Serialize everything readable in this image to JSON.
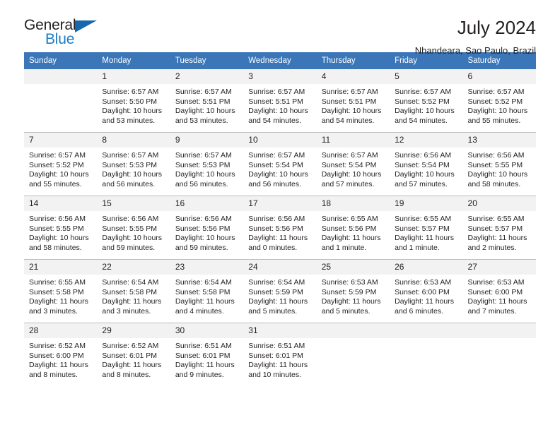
{
  "brand": {
    "name_part1": "General",
    "name_part2": "Blue",
    "triangle_color": "#1667ad",
    "blue_color": "#1e7bc4"
  },
  "header": {
    "title": "July 2024",
    "subtitle": "Nhandeara, Sao Paulo, Brazil",
    "header_bg": "#3a76b8",
    "daynum_bg": "#f2f2f2"
  },
  "weekday_headers": [
    "Sunday",
    "Monday",
    "Tuesday",
    "Wednesday",
    "Thursday",
    "Friday",
    "Saturday"
  ],
  "labels": {
    "sunrise": "Sunrise:",
    "sunset": "Sunset:",
    "daylight": "Daylight:"
  },
  "weeks": [
    [
      {
        "day": "",
        "sunrise": "",
        "sunset": "",
        "daylight_line1": "",
        "daylight_line2": ""
      },
      {
        "day": "1",
        "sunrise": "Sunrise: 6:57 AM",
        "sunset": "Sunset: 5:50 PM",
        "daylight_line1": "Daylight: 10 hours",
        "daylight_line2": "and 53 minutes."
      },
      {
        "day": "2",
        "sunrise": "Sunrise: 6:57 AM",
        "sunset": "Sunset: 5:51 PM",
        "daylight_line1": "Daylight: 10 hours",
        "daylight_line2": "and 53 minutes."
      },
      {
        "day": "3",
        "sunrise": "Sunrise: 6:57 AM",
        "sunset": "Sunset: 5:51 PM",
        "daylight_line1": "Daylight: 10 hours",
        "daylight_line2": "and 54 minutes."
      },
      {
        "day": "4",
        "sunrise": "Sunrise: 6:57 AM",
        "sunset": "Sunset: 5:51 PM",
        "daylight_line1": "Daylight: 10 hours",
        "daylight_line2": "and 54 minutes."
      },
      {
        "day": "5",
        "sunrise": "Sunrise: 6:57 AM",
        "sunset": "Sunset: 5:52 PM",
        "daylight_line1": "Daylight: 10 hours",
        "daylight_line2": "and 54 minutes."
      },
      {
        "day": "6",
        "sunrise": "Sunrise: 6:57 AM",
        "sunset": "Sunset: 5:52 PM",
        "daylight_line1": "Daylight: 10 hours",
        "daylight_line2": "and 55 minutes."
      }
    ],
    [
      {
        "day": "7",
        "sunrise": "Sunrise: 6:57 AM",
        "sunset": "Sunset: 5:52 PM",
        "daylight_line1": "Daylight: 10 hours",
        "daylight_line2": "and 55 minutes."
      },
      {
        "day": "8",
        "sunrise": "Sunrise: 6:57 AM",
        "sunset": "Sunset: 5:53 PM",
        "daylight_line1": "Daylight: 10 hours",
        "daylight_line2": "and 56 minutes."
      },
      {
        "day": "9",
        "sunrise": "Sunrise: 6:57 AM",
        "sunset": "Sunset: 5:53 PM",
        "daylight_line1": "Daylight: 10 hours",
        "daylight_line2": "and 56 minutes."
      },
      {
        "day": "10",
        "sunrise": "Sunrise: 6:57 AM",
        "sunset": "Sunset: 5:54 PM",
        "daylight_line1": "Daylight: 10 hours",
        "daylight_line2": "and 56 minutes."
      },
      {
        "day": "11",
        "sunrise": "Sunrise: 6:57 AM",
        "sunset": "Sunset: 5:54 PM",
        "daylight_line1": "Daylight: 10 hours",
        "daylight_line2": "and 57 minutes."
      },
      {
        "day": "12",
        "sunrise": "Sunrise: 6:56 AM",
        "sunset": "Sunset: 5:54 PM",
        "daylight_line1": "Daylight: 10 hours",
        "daylight_line2": "and 57 minutes."
      },
      {
        "day": "13",
        "sunrise": "Sunrise: 6:56 AM",
        "sunset": "Sunset: 5:55 PM",
        "daylight_line1": "Daylight: 10 hours",
        "daylight_line2": "and 58 minutes."
      }
    ],
    [
      {
        "day": "14",
        "sunrise": "Sunrise: 6:56 AM",
        "sunset": "Sunset: 5:55 PM",
        "daylight_line1": "Daylight: 10 hours",
        "daylight_line2": "and 58 minutes."
      },
      {
        "day": "15",
        "sunrise": "Sunrise: 6:56 AM",
        "sunset": "Sunset: 5:55 PM",
        "daylight_line1": "Daylight: 10 hours",
        "daylight_line2": "and 59 minutes."
      },
      {
        "day": "16",
        "sunrise": "Sunrise: 6:56 AM",
        "sunset": "Sunset: 5:56 PM",
        "daylight_line1": "Daylight: 10 hours",
        "daylight_line2": "and 59 minutes."
      },
      {
        "day": "17",
        "sunrise": "Sunrise: 6:56 AM",
        "sunset": "Sunset: 5:56 PM",
        "daylight_line1": "Daylight: 11 hours",
        "daylight_line2": "and 0 minutes."
      },
      {
        "day": "18",
        "sunrise": "Sunrise: 6:55 AM",
        "sunset": "Sunset: 5:56 PM",
        "daylight_line1": "Daylight: 11 hours",
        "daylight_line2": "and 1 minute."
      },
      {
        "day": "19",
        "sunrise": "Sunrise: 6:55 AM",
        "sunset": "Sunset: 5:57 PM",
        "daylight_line1": "Daylight: 11 hours",
        "daylight_line2": "and 1 minute."
      },
      {
        "day": "20",
        "sunrise": "Sunrise: 6:55 AM",
        "sunset": "Sunset: 5:57 PM",
        "daylight_line1": "Daylight: 11 hours",
        "daylight_line2": "and 2 minutes."
      }
    ],
    [
      {
        "day": "21",
        "sunrise": "Sunrise: 6:55 AM",
        "sunset": "Sunset: 5:58 PM",
        "daylight_line1": "Daylight: 11 hours",
        "daylight_line2": "and 3 minutes."
      },
      {
        "day": "22",
        "sunrise": "Sunrise: 6:54 AM",
        "sunset": "Sunset: 5:58 PM",
        "daylight_line1": "Daylight: 11 hours",
        "daylight_line2": "and 3 minutes."
      },
      {
        "day": "23",
        "sunrise": "Sunrise: 6:54 AM",
        "sunset": "Sunset: 5:58 PM",
        "daylight_line1": "Daylight: 11 hours",
        "daylight_line2": "and 4 minutes."
      },
      {
        "day": "24",
        "sunrise": "Sunrise: 6:54 AM",
        "sunset": "Sunset: 5:59 PM",
        "daylight_line1": "Daylight: 11 hours",
        "daylight_line2": "and 5 minutes."
      },
      {
        "day": "25",
        "sunrise": "Sunrise: 6:53 AM",
        "sunset": "Sunset: 5:59 PM",
        "daylight_line1": "Daylight: 11 hours",
        "daylight_line2": "and 5 minutes."
      },
      {
        "day": "26",
        "sunrise": "Sunrise: 6:53 AM",
        "sunset": "Sunset: 6:00 PM",
        "daylight_line1": "Daylight: 11 hours",
        "daylight_line2": "and 6 minutes."
      },
      {
        "day": "27",
        "sunrise": "Sunrise: 6:53 AM",
        "sunset": "Sunset: 6:00 PM",
        "daylight_line1": "Daylight: 11 hours",
        "daylight_line2": "and 7 minutes."
      }
    ],
    [
      {
        "day": "28",
        "sunrise": "Sunrise: 6:52 AM",
        "sunset": "Sunset: 6:00 PM",
        "daylight_line1": "Daylight: 11 hours",
        "daylight_line2": "and 8 minutes."
      },
      {
        "day": "29",
        "sunrise": "Sunrise: 6:52 AM",
        "sunset": "Sunset: 6:01 PM",
        "daylight_line1": "Daylight: 11 hours",
        "daylight_line2": "and 8 minutes."
      },
      {
        "day": "30",
        "sunrise": "Sunrise: 6:51 AM",
        "sunset": "Sunset: 6:01 PM",
        "daylight_line1": "Daylight: 11 hours",
        "daylight_line2": "and 9 minutes."
      },
      {
        "day": "31",
        "sunrise": "Sunrise: 6:51 AM",
        "sunset": "Sunset: 6:01 PM",
        "daylight_line1": "Daylight: 11 hours",
        "daylight_line2": "and 10 minutes."
      },
      {
        "day": "",
        "sunrise": "",
        "sunset": "",
        "daylight_line1": "",
        "daylight_line2": ""
      },
      {
        "day": "",
        "sunrise": "",
        "sunset": "",
        "daylight_line1": "",
        "daylight_line2": ""
      },
      {
        "day": "",
        "sunrise": "",
        "sunset": "",
        "daylight_line1": "",
        "daylight_line2": ""
      }
    ]
  ]
}
